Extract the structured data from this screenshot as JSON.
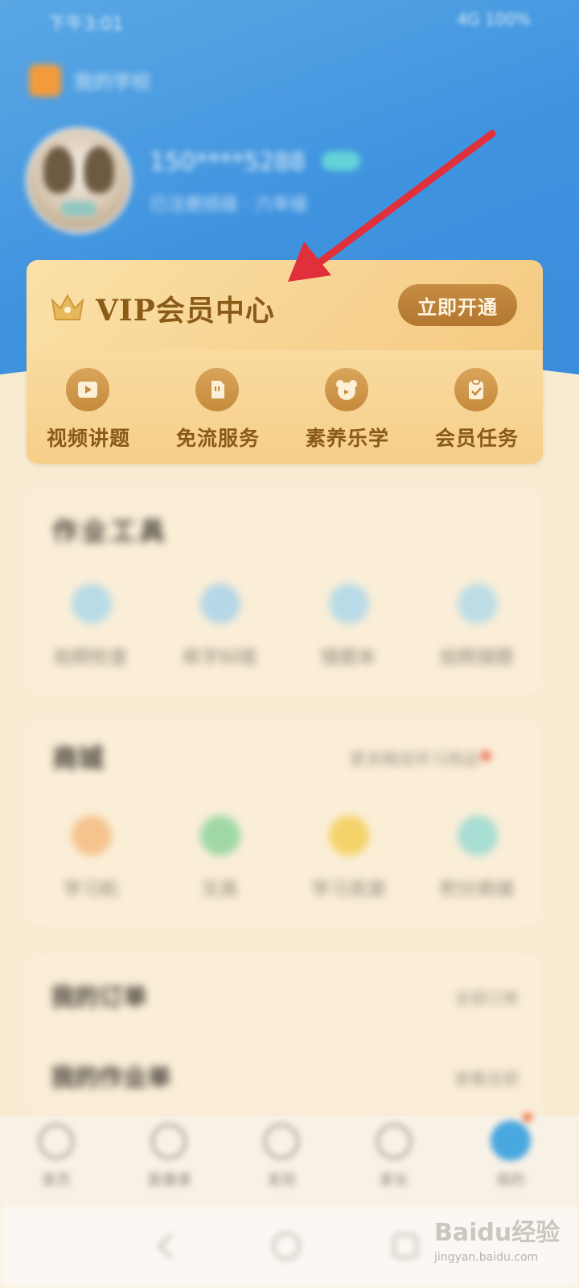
{
  "status_bar": {
    "time": "下午3:01",
    "right": "4G 100%"
  },
  "header": {
    "school": "我的学校",
    "user_phone": "150****5288",
    "user_info": "已注册班级 · 六年级"
  },
  "vip": {
    "title": "VIP会员中心",
    "open_button": "立即开通",
    "items": [
      {
        "label": "视频讲题",
        "icon": "video-play-icon"
      },
      {
        "label": "免流服务",
        "icon": "sim-card-icon"
      },
      {
        "label": "素养乐学",
        "icon": "bear-face-icon"
      },
      {
        "label": "会员任务",
        "icon": "clipboard-check-icon"
      }
    ]
  },
  "homework_tools": {
    "title": "作业工具",
    "items": [
      {
        "label": "拍照检查"
      },
      {
        "label": "练字纠错"
      },
      {
        "label": "错题本"
      },
      {
        "label": "拍照搜题"
      }
    ]
  },
  "mall": {
    "title": "商城",
    "right_text": "更多精选学习用品",
    "items": [
      {
        "label": "学习机"
      },
      {
        "label": "文具"
      },
      {
        "label": "学习资源"
      },
      {
        "label": "积分商城"
      }
    ]
  },
  "rows": [
    {
      "title": "我的订单",
      "right": "全部订单"
    },
    {
      "title": "我的作业单",
      "right": "查看全部"
    }
  ],
  "bottom_nav": {
    "items": [
      {
        "label": "首页",
        "icon": "home-icon"
      },
      {
        "label": "直播课",
        "icon": "live-icon"
      },
      {
        "label": "发现",
        "icon": "discover-icon"
      },
      {
        "label": "家长",
        "icon": "parent-icon"
      },
      {
        "label": "我的",
        "icon": "profile-icon"
      }
    ]
  },
  "watermark": {
    "main": "Baidu经验",
    "sub": "jingyan.baidu.com"
  },
  "colors": {
    "header_blue": "#3f93df",
    "vip_gold": "#f7d391",
    "vip_text": "#8a5a17",
    "vip_button": "#b37730",
    "arrow_red": "#e0303c",
    "page_bg": "#f7ebd2"
  }
}
